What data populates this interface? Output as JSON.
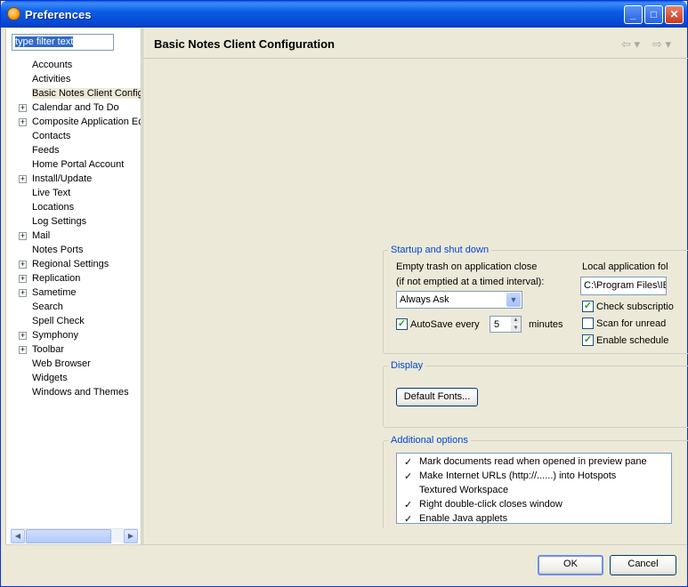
{
  "window": {
    "title": "Preferences"
  },
  "filter": {
    "text": "type filter text"
  },
  "tree": [
    {
      "label": "Accounts",
      "expandable": false
    },
    {
      "label": "Activities",
      "expandable": false
    },
    {
      "label": "Basic Notes Client Config",
      "expandable": false,
      "selected": true
    },
    {
      "label": "Calendar and To Do",
      "expandable": true
    },
    {
      "label": "Composite Application Ed",
      "expandable": true
    },
    {
      "label": "Contacts",
      "expandable": false
    },
    {
      "label": "Feeds",
      "expandable": false
    },
    {
      "label": "Home Portal Account",
      "expandable": false
    },
    {
      "label": "Install/Update",
      "expandable": true
    },
    {
      "label": "Live Text",
      "expandable": false
    },
    {
      "label": "Locations",
      "expandable": false
    },
    {
      "label": "Log Settings",
      "expandable": false
    },
    {
      "label": "Mail",
      "expandable": true
    },
    {
      "label": "Notes Ports",
      "expandable": false
    },
    {
      "label": "Regional Settings",
      "expandable": true
    },
    {
      "label": "Replication",
      "expandable": true
    },
    {
      "label": "Sametime",
      "expandable": true
    },
    {
      "label": "Search",
      "expandable": false
    },
    {
      "label": "Spell Check",
      "expandable": false
    },
    {
      "label": "Symphony",
      "expandable": true
    },
    {
      "label": "Toolbar",
      "expandable": true
    },
    {
      "label": "Web Browser",
      "expandable": false
    },
    {
      "label": "Widgets",
      "expandable": false
    },
    {
      "label": "Windows and Themes",
      "expandable": false
    }
  ],
  "page": {
    "title": "Basic Notes Client Configuration"
  },
  "startup": {
    "title": "Startup and shut down",
    "empty_trash_label": "Empty trash on application close",
    "empty_trash_sub": "(if not emptied at a timed interval):",
    "empty_trash_value": "Always Ask",
    "autosave_label": "AutoSave every",
    "autosave_value": "5",
    "autosave_unit": "minutes",
    "local_folder_label": "Local application fol",
    "local_folder_value": "C:\\Program Files\\IB",
    "check_subscriptions_label": "Check subscriptio",
    "scan_unread_label": "Scan for unread",
    "enable_scheduled_label": "Enable schedule"
  },
  "display": {
    "title": "Display",
    "default_fonts_label": "Default Fonts..."
  },
  "additional": {
    "title": "Additional options",
    "items": [
      {
        "label": "Mark documents read when opened in preview pane",
        "checked": true
      },
      {
        "label": "Make Internet URLs (http://......) into Hotspots",
        "checked": true
      },
      {
        "label": "Textured Workspace",
        "checked": false
      },
      {
        "label": "Right double-click closes window",
        "checked": true
      },
      {
        "label": "Enable Java applets",
        "checked": true
      }
    ]
  },
  "buttons": {
    "ok": "OK",
    "cancel": "Cancel"
  }
}
